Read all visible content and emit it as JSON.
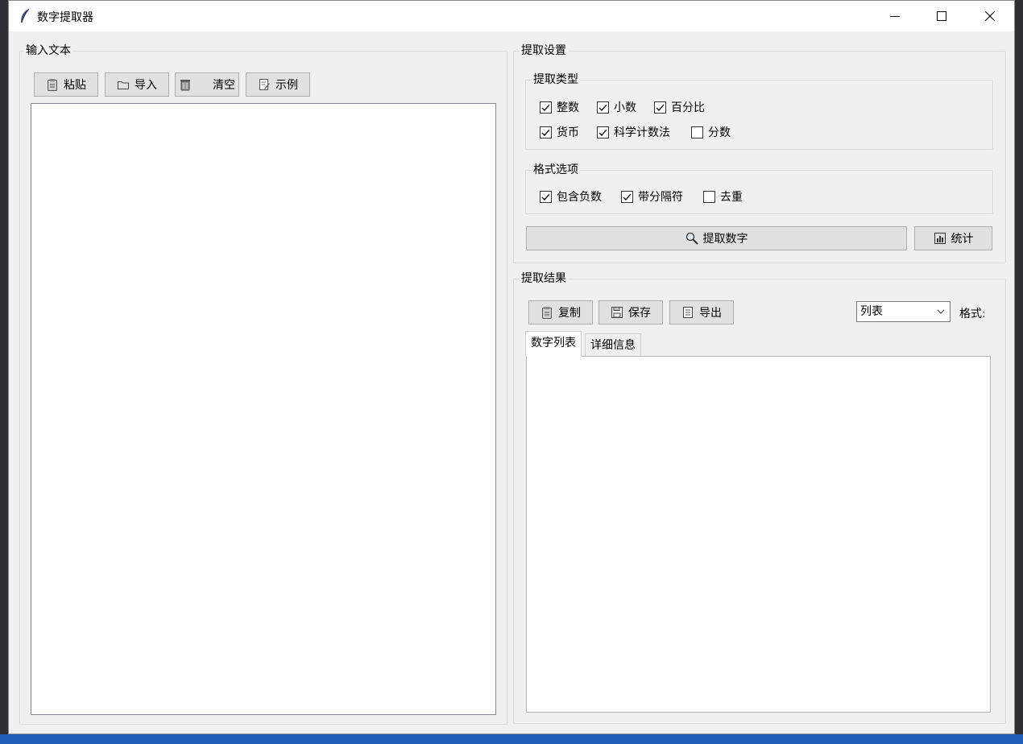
{
  "window": {
    "title": "数字提取器"
  },
  "input_group": {
    "label": "输入文本",
    "buttons": {
      "paste": "粘贴",
      "import": "导入",
      "clear": "清空",
      "example": "示例"
    },
    "text": ""
  },
  "settings_group": {
    "label": "提取设置",
    "type_group": {
      "label": "提取类型",
      "options": [
        {
          "label": "整数",
          "checked": true
        },
        {
          "label": "小数",
          "checked": true
        },
        {
          "label": "百分比",
          "checked": true
        },
        {
          "label": "货币",
          "checked": true
        },
        {
          "label": "科学计数法",
          "checked": true
        },
        {
          "label": "分数",
          "checked": false
        }
      ]
    },
    "format_group": {
      "label": "格式选项",
      "options": [
        {
          "label": "包含负数",
          "checked": true
        },
        {
          "label": "带分隔符",
          "checked": true
        },
        {
          "label": "去重",
          "checked": false
        }
      ]
    },
    "extract_button": "提取数字",
    "stats_button": "统计"
  },
  "results_group": {
    "label": "提取结果",
    "buttons": {
      "copy": "复制",
      "save": "保存",
      "export": "导出"
    },
    "format_select": "列表",
    "format_label": "格式:",
    "tabs": [
      {
        "label": "数字列表",
        "active": true
      },
      {
        "label": "详细信息",
        "active": false
      }
    ],
    "content": ""
  }
}
